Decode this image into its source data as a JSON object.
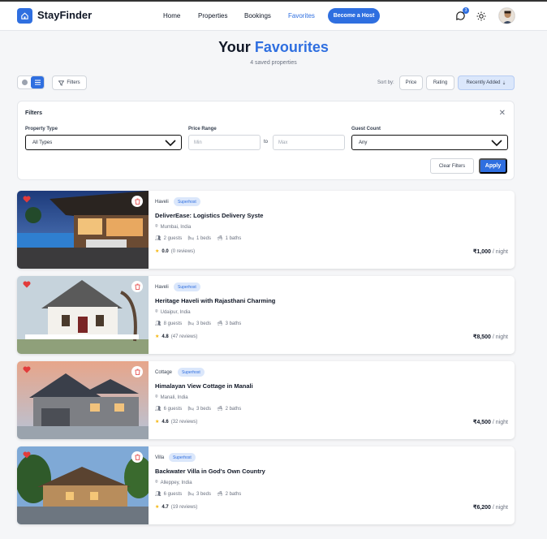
{
  "nav": {
    "brand": "StayFinder",
    "links": [
      "Home",
      "Properties",
      "Bookings",
      "Favorites"
    ],
    "active": "Favorites",
    "host_button": "Become a Host",
    "chat_badge": "3",
    "accent": "#2f6fe0"
  },
  "header": {
    "title_prefix": "Your",
    "title_accent": "Favourites",
    "subtitle": "4 saved properties"
  },
  "toolbar": {
    "filters_label": "Filters",
    "sort_label": "Sort by:",
    "sort_options": [
      "Price",
      "Rating",
      "Recently Added"
    ],
    "sort_active": "Recently Added"
  },
  "filter_panel": {
    "title": "Filters",
    "property_type_label": "Property Type",
    "property_type_value": "All Types",
    "price_range_label": "Price Range",
    "min_placeholder": "Min",
    "max_placeholder": "Max",
    "to_label": "to",
    "guest_count_label": "Guest Count",
    "guest_count_value": "Any",
    "clear_label": "Clear Filters",
    "apply_label": "Apply"
  },
  "properties": [
    {
      "type": "Haveli",
      "badge": "Superhost",
      "title": "DeliverEase: Logistics Delivery Syste",
      "location": "Mumbai, India",
      "guests": "2 guests",
      "beds": "1 beds",
      "baths": "1 baths",
      "rating": "0.0",
      "reviews": "(0 reviews)",
      "price": "₹1,000",
      "per": "/ night"
    },
    {
      "type": "Haveli",
      "badge": "Superhost",
      "title": "Heritage Haveli with Rajasthani Charming",
      "location": "Udaipur, India",
      "guests": "8 guests",
      "beds": "3 beds",
      "baths": "3 baths",
      "rating": "4.8",
      "reviews": "(47 reviews)",
      "price": "₹8,500",
      "per": "/ night"
    },
    {
      "type": "Cottage",
      "badge": "Superhost",
      "title": "Himalayan View Cottage in Manali",
      "location": "Manali, India",
      "guests": "6 guests",
      "beds": "3 beds",
      "baths": "2 baths",
      "rating": "4.6",
      "reviews": "(32 reviews)",
      "price": "₹4,500",
      "per": "/ night"
    },
    {
      "type": "Villa",
      "badge": "Superhost",
      "title": "Backwater Villa in God's Own Country",
      "location": "Alleppey, India",
      "guests": "6 guests",
      "beds": "3 beds",
      "baths": "2 baths",
      "rating": "4.7",
      "reviews": "(19 reviews)",
      "price": "₹6,200",
      "per": "/ night"
    }
  ]
}
